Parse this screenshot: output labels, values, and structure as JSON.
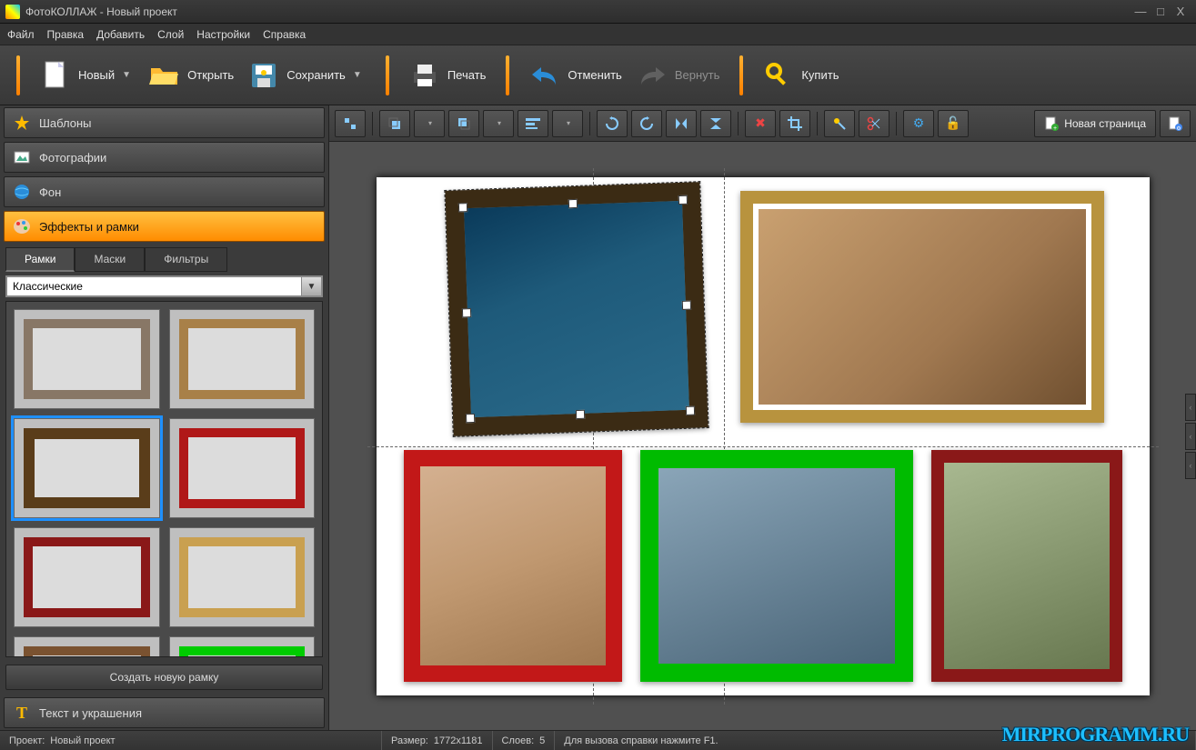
{
  "window": {
    "title": "ФотоКОЛЛАЖ - Новый проект"
  },
  "menu": {
    "file": "Файл",
    "edit": "Правка",
    "add": "Добавить",
    "layer": "Слой",
    "settings": "Настройки",
    "help": "Справка"
  },
  "toolbar": {
    "new": "Новый",
    "open": "Открыть",
    "save": "Сохранить",
    "print": "Печать",
    "undo": "Отменить",
    "redo": "Вернуть",
    "buy": "Купить"
  },
  "sidebar": {
    "templates": "Шаблоны",
    "photos": "Фотографии",
    "background": "Фон",
    "effects": "Эффекты и рамки",
    "text_decor": "Текст и украшения",
    "tabs": {
      "frames": "Рамки",
      "masks": "Маски",
      "filters": "Фильтры"
    },
    "frame_category_selected": "Классические",
    "create_frame": "Создать новую рамку"
  },
  "canvas_toolbar": {
    "new_page": "Новая страница"
  },
  "status": {
    "project_label": "Проект:",
    "project_name": "Новый проект",
    "size_label": "Размер:",
    "size_value": "1772х1181",
    "layers_label": "Слоев:",
    "layers_value": "5",
    "help_hint": "Для вызова справки нажмите F1."
  },
  "watermark": "MIRPROGRAMM.RU"
}
